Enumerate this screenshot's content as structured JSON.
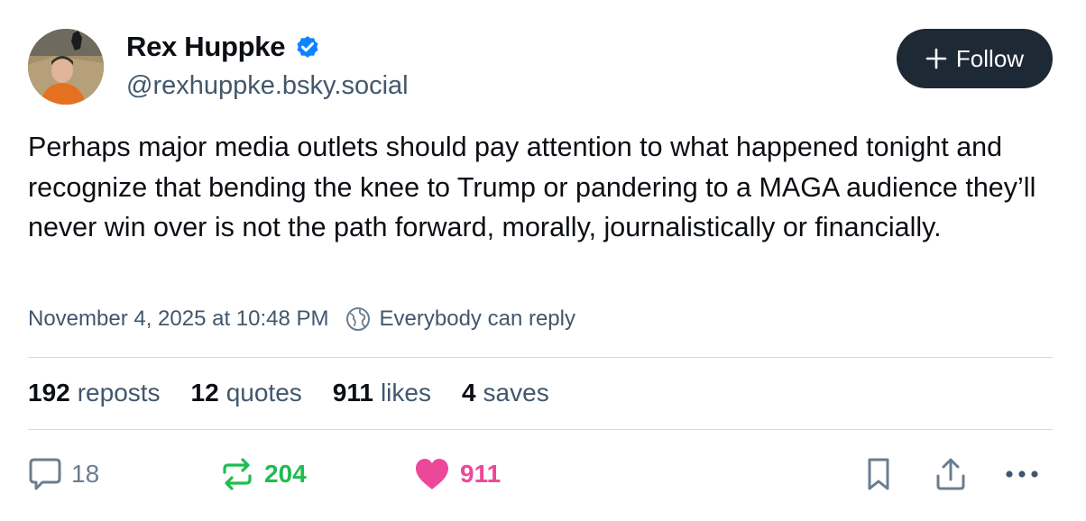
{
  "author": {
    "display_name": "Rex Huppke",
    "handle": "@rexhuppke.bsky.social",
    "verified": true,
    "avatar_icon": "user-avatar"
  },
  "follow": {
    "label": "Follow",
    "icon": "plus-icon"
  },
  "post": {
    "text": "Perhaps major media outlets should pay attention to what happened tonight and recognize that bending the knee to Trump or pandering to a MAGA audience they’ll never win over is not the path forward, morally, journalistically or financially.",
    "timestamp": "November 4, 2025 at 10:48 PM",
    "reply_setting": "Everybody can reply"
  },
  "stats": {
    "reposts": {
      "count": "192",
      "label": "reposts"
    },
    "quotes": {
      "count": "12",
      "label": "quotes"
    },
    "likes": {
      "count": "911",
      "label": "likes"
    },
    "saves": {
      "count": "4",
      "label": "saves"
    }
  },
  "actions": {
    "reply": {
      "count": "18",
      "icon": "reply-bubble-icon",
      "color": "#6b7d90"
    },
    "repost": {
      "count": "204",
      "icon": "repost-icon",
      "color": "#20bc50"
    },
    "like": {
      "count": "911",
      "icon": "heart-icon",
      "color": "#ec4899"
    },
    "bookmark": {
      "icon": "bookmark-icon"
    },
    "share": {
      "icon": "share-icon"
    },
    "more": {
      "icon": "more-options-icon"
    }
  },
  "colors": {
    "verified_blue": "#1083fe",
    "follow_bg": "#1e2936",
    "secondary_text": "#42576c",
    "divider": "#d4dbe2"
  }
}
